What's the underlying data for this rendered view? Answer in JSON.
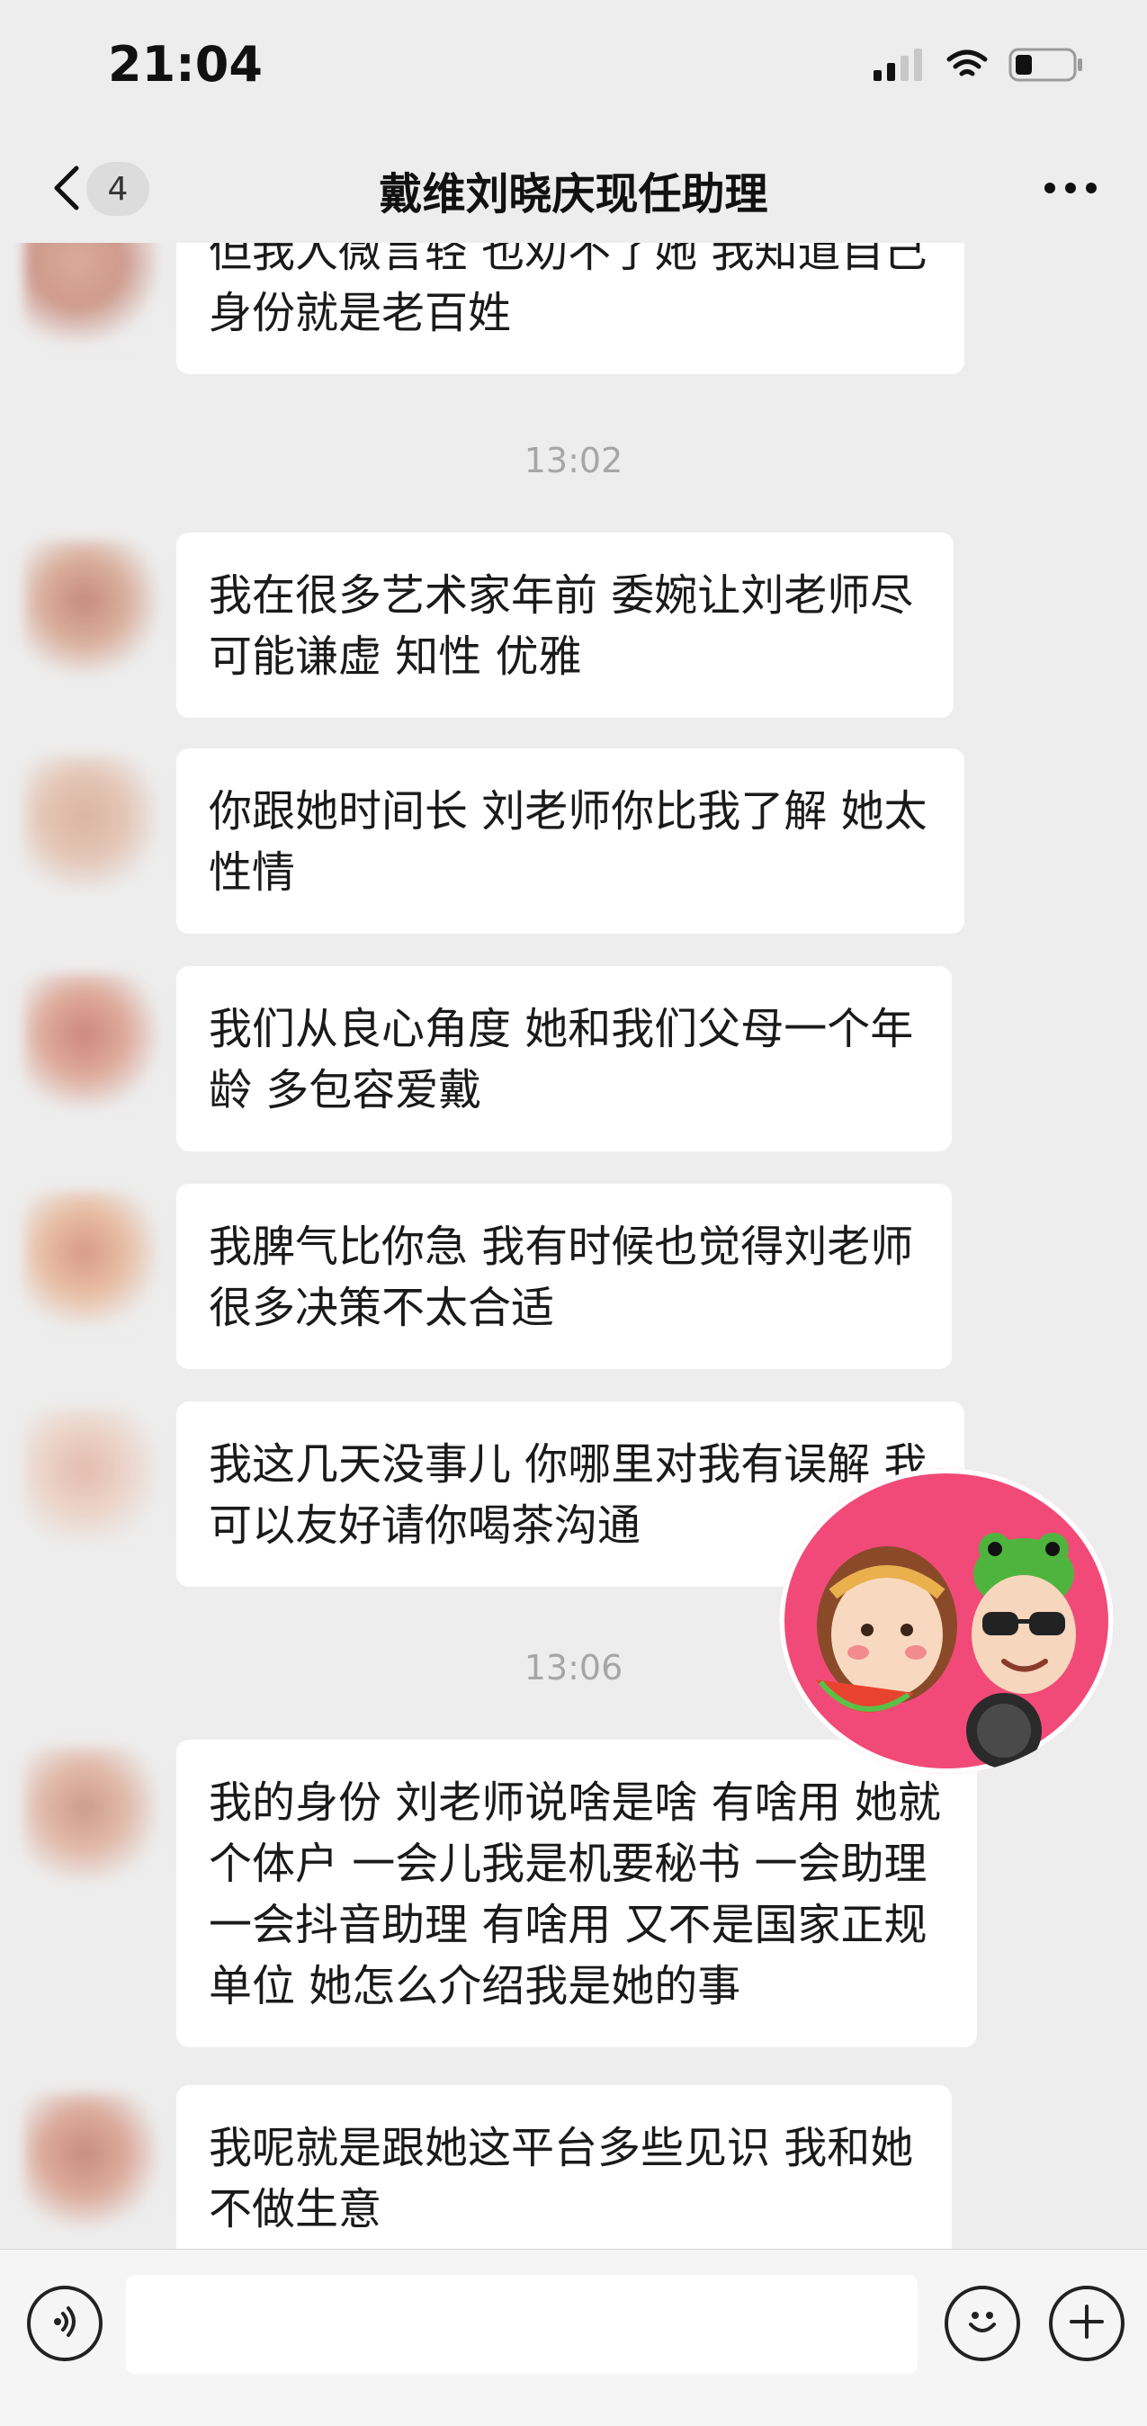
{
  "status_bar": {
    "time": "21:04"
  },
  "nav": {
    "unread_count": "4",
    "title": "戴维刘晓庆现任助理"
  },
  "chat": {
    "messages": [
      {
        "text": "但我人微言轻 也劝不了她 我知道自己身份就是老百姓"
      },
      {
        "text": "我在很多艺术家年前 委婉让刘老师尽可能谦虚 知性 优雅"
      },
      {
        "text": "你跟她时间长 刘老师你比我了解 她太性情"
      },
      {
        "text": "我们从良心角度 她和我们父母一个年龄 多包容爱戴"
      },
      {
        "text": "我脾气比你急 我有时候也觉得刘老师很多决策不太合适"
      },
      {
        "text": "我这几天没事儿 你哪里对我有误解 我可以友好请你喝茶沟通"
      },
      {
        "text": "我的身份 刘老师说啥是啥 有啥用 她就个体户 一会儿我是机要秘书 一会助理 一会抖音助理 有啥用 又不是国家正规单位 她怎么介绍我是她的事"
      },
      {
        "text": "我呢就是跟她这平台多些见识 我和她不做生意"
      }
    ],
    "timestamps": [
      "13:02",
      "13:06"
    ]
  },
  "input_bar": {
    "placeholder": ""
  },
  "icons": {
    "back": "chevron-left-icon",
    "more": "more-dots-icon",
    "voice": "voice-icon",
    "emoji": "emoji-icon",
    "plus": "plus-icon",
    "signal": "signal-icon",
    "wifi": "wifi-icon",
    "battery": "battery-icon"
  },
  "colors": {
    "background": "#ededed",
    "bubble": "#ffffff",
    "sticker": "#f24a78"
  }
}
